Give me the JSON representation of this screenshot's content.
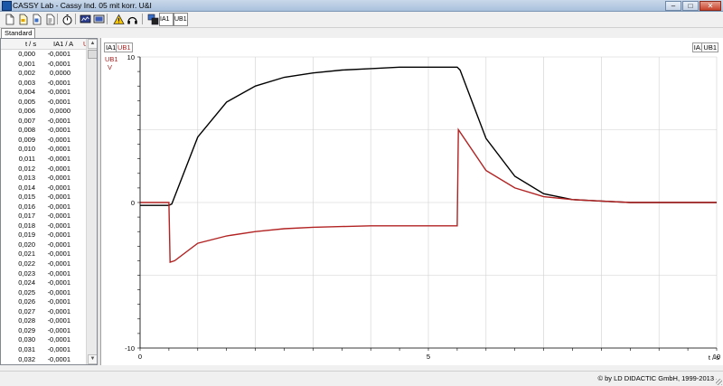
{
  "window": {
    "title": "CASSY Lab - Cassy Ind. 05 mit korr. U&I",
    "min": "–",
    "max": "□",
    "close": "✕"
  },
  "toolbar": {
    "icons": [
      "new-file",
      "open-file",
      "save-file",
      "print",
      "stopwatch",
      "display",
      "monitor",
      "warning",
      "headphones",
      "measure-params",
      "channel-ia1",
      "channel-ub1"
    ],
    "ia1_label": "IA1",
    "ub1_label": "UB1"
  },
  "tab": {
    "label": "Standard"
  },
  "table": {
    "headers": {
      "t": "t / s",
      "i": "IA1 / A",
      "u": "U"
    },
    "rows": [
      [
        "0,000",
        "-0,0001"
      ],
      [
        "0,001",
        "-0,0001"
      ],
      [
        "0,002",
        "0,0000"
      ],
      [
        "0,003",
        "-0,0001"
      ],
      [
        "0,004",
        "-0,0001"
      ],
      [
        "0,005",
        "-0,0001"
      ],
      [
        "0,006",
        "0,0000"
      ],
      [
        "0,007",
        "-0,0001"
      ],
      [
        "0,008",
        "-0,0001"
      ],
      [
        "0,009",
        "-0,0001"
      ],
      [
        "0,010",
        "-0,0001"
      ],
      [
        "0,011",
        "-0,0001"
      ],
      [
        "0,012",
        "-0,0001"
      ],
      [
        "0,013",
        "-0,0001"
      ],
      [
        "0,014",
        "-0,0001"
      ],
      [
        "0,015",
        "-0,0001"
      ],
      [
        "0,016",
        "-0,0001"
      ],
      [
        "0,017",
        "-0,0001"
      ],
      [
        "0,018",
        "-0,0001"
      ],
      [
        "0,019",
        "-0,0001"
      ],
      [
        "0,020",
        "-0,0001"
      ],
      [
        "0,021",
        "-0,0001"
      ],
      [
        "0,022",
        "-0,0001"
      ],
      [
        "0,023",
        "-0,0001"
      ],
      [
        "0,024",
        "-0,0001"
      ],
      [
        "0,025",
        "-0,0001"
      ],
      [
        "0,026",
        "-0,0001"
      ],
      [
        "0,027",
        "-0,0001"
      ],
      [
        "0,028",
        "-0,0001"
      ],
      [
        "0,029",
        "-0,0001"
      ],
      [
        "0,030",
        "-0,0001"
      ],
      [
        "0,031",
        "-0,0001"
      ],
      [
        "0,032",
        "-0,0001"
      ]
    ]
  },
  "graph": {
    "left_labels": {
      "ia1": "IA1",
      "ub1": "UB1",
      "ub1_unit": "V"
    },
    "right_labels": {
      "ia1": "IA1",
      "ub1": "UB1"
    },
    "y_ticks": [
      "10",
      "0",
      "-10"
    ],
    "x_ticks": [
      "0",
      "5",
      "10"
    ],
    "x_axis_label": "t / s"
  },
  "chart_data": {
    "type": "line",
    "xlabel": "t / s",
    "xlim": [
      0,
      10
    ],
    "ylim": [
      -10,
      10
    ],
    "grid": true,
    "series": [
      {
        "name": "IA1",
        "color": "#000000",
        "x": [
          0,
          0.5,
          0.55,
          1.0,
          1.5,
          2.0,
          2.5,
          3.0,
          3.5,
          4.0,
          4.5,
          5.0,
          5.5,
          5.55,
          6.0,
          6.5,
          7.0,
          7.5,
          8.0,
          8.5,
          9.0,
          10.0
        ],
        "y": [
          -0.2,
          -0.2,
          -0.1,
          4.5,
          6.9,
          8.0,
          8.6,
          8.9,
          9.1,
          9.2,
          9.3,
          9.3,
          9.3,
          9.1,
          4.4,
          1.8,
          0.6,
          0.2,
          0.1,
          0.0,
          0.0,
          0.0
        ]
      },
      {
        "name": "UB1",
        "color": "#b22222",
        "x": [
          0,
          0.5,
          0.52,
          0.6,
          1.0,
          1.5,
          2.0,
          2.5,
          3.0,
          3.5,
          4.0,
          4.5,
          5.0,
          5.5,
          5.52,
          6.0,
          6.5,
          7.0,
          7.5,
          8.0,
          8.5,
          9.0,
          10.0
        ],
        "y": [
          0.0,
          0.0,
          -4.1,
          -4.0,
          -2.8,
          -2.3,
          -2.0,
          -1.8,
          -1.7,
          -1.65,
          -1.6,
          -1.6,
          -1.6,
          -1.6,
          5.0,
          2.2,
          1.0,
          0.4,
          0.2,
          0.1,
          0.0,
          0.0,
          0.0
        ]
      }
    ]
  },
  "status": {
    "copyright": "© by LD DIDACTIC GmbH, 1999-2013"
  }
}
